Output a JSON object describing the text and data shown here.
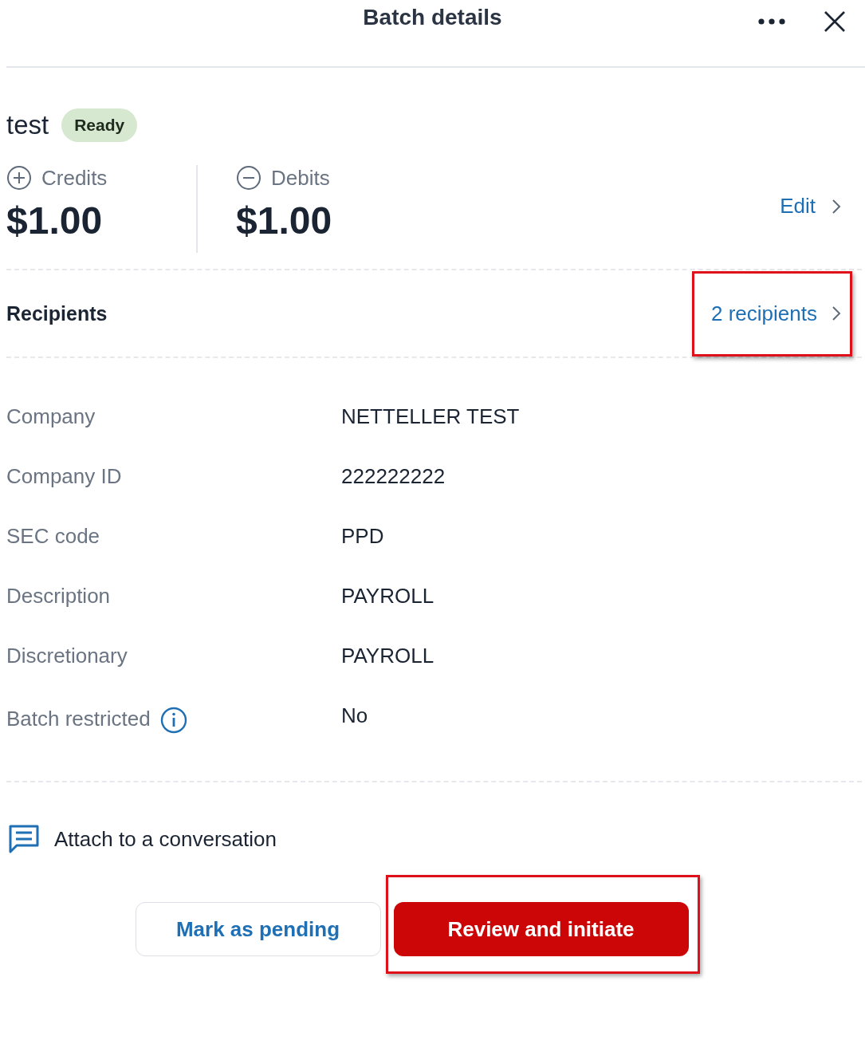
{
  "header": {
    "title": "Batch details"
  },
  "batch": {
    "name": "test",
    "status": "Ready"
  },
  "totals": [
    {
      "kind": "credit",
      "label": "Credits",
      "amount": "$1.00"
    },
    {
      "kind": "debit",
      "label": "Debits",
      "amount": "$1.00"
    }
  ],
  "edit_link": "Edit",
  "recipients": {
    "label": "Recipients",
    "link": "2 recipients",
    "highlighted": true
  },
  "details": [
    {
      "label": "Company",
      "value": "NETTELLER TEST",
      "info": false
    },
    {
      "label": "Company ID",
      "value": "222222222",
      "info": false
    },
    {
      "label": "SEC code",
      "value": "PPD",
      "info": false
    },
    {
      "label": "Description",
      "value": "PAYROLL",
      "info": false
    },
    {
      "label": "Discretionary",
      "value": "PAYROLL",
      "info": false
    },
    {
      "label": "Batch restricted",
      "value": "No",
      "info": true
    }
  ],
  "attach": "Attach to a conversation",
  "buttons": [
    {
      "kind": "secondary",
      "label": "Mark as pending",
      "highlighted": false
    },
    {
      "kind": "primary",
      "label": "Review and initiate",
      "highlighted": true
    }
  ]
}
